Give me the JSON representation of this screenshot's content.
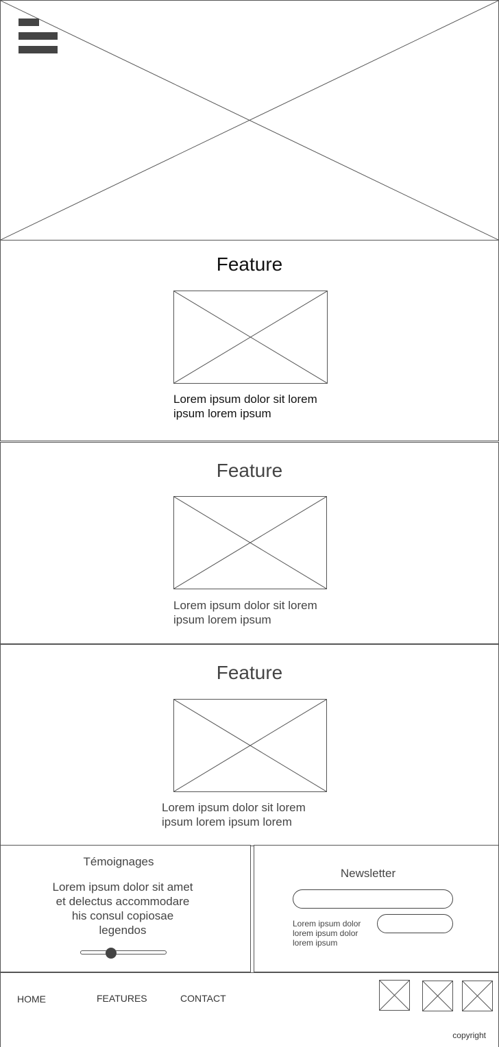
{
  "hero": {
    "menu_icon": "hamburger-menu-icon",
    "image_icon": "image-placeholder-icon"
  },
  "features": [
    {
      "title": "Feature",
      "text": "Lorem ipsum dolor sit lorem ipsum lorem ipsum"
    },
    {
      "title": "Feature",
      "text": "Lorem ipsum dolor sit lorem ipsum lorem ipsum"
    },
    {
      "title": "Feature",
      "text": "Lorem ipsum dolor sit lorem ipsum lorem ipsum lorem"
    }
  ],
  "testimonials": {
    "title": "Témoignages",
    "text": "Lorem ipsum dolor sit amet et delectus accommodare his consul copiosae legendos",
    "slider_value_fraction": 0.36
  },
  "newsletter": {
    "title": "Newsletter",
    "email_value": "",
    "description": "Lorem ipsum dolor lorem ipsum dolor lorem ipsum",
    "submit_label": ""
  },
  "footer": {
    "nav": [
      "HOME",
      "FEATURES",
      "CONTACT"
    ],
    "social_icons": [
      "image-placeholder-icon",
      "image-placeholder-icon",
      "image-placeholder-icon"
    ],
    "copyright": "copyright"
  },
  "colors": {
    "stroke": "#555555",
    "text": "#444444",
    "fill": "#444444",
    "background": "#ffffff"
  }
}
